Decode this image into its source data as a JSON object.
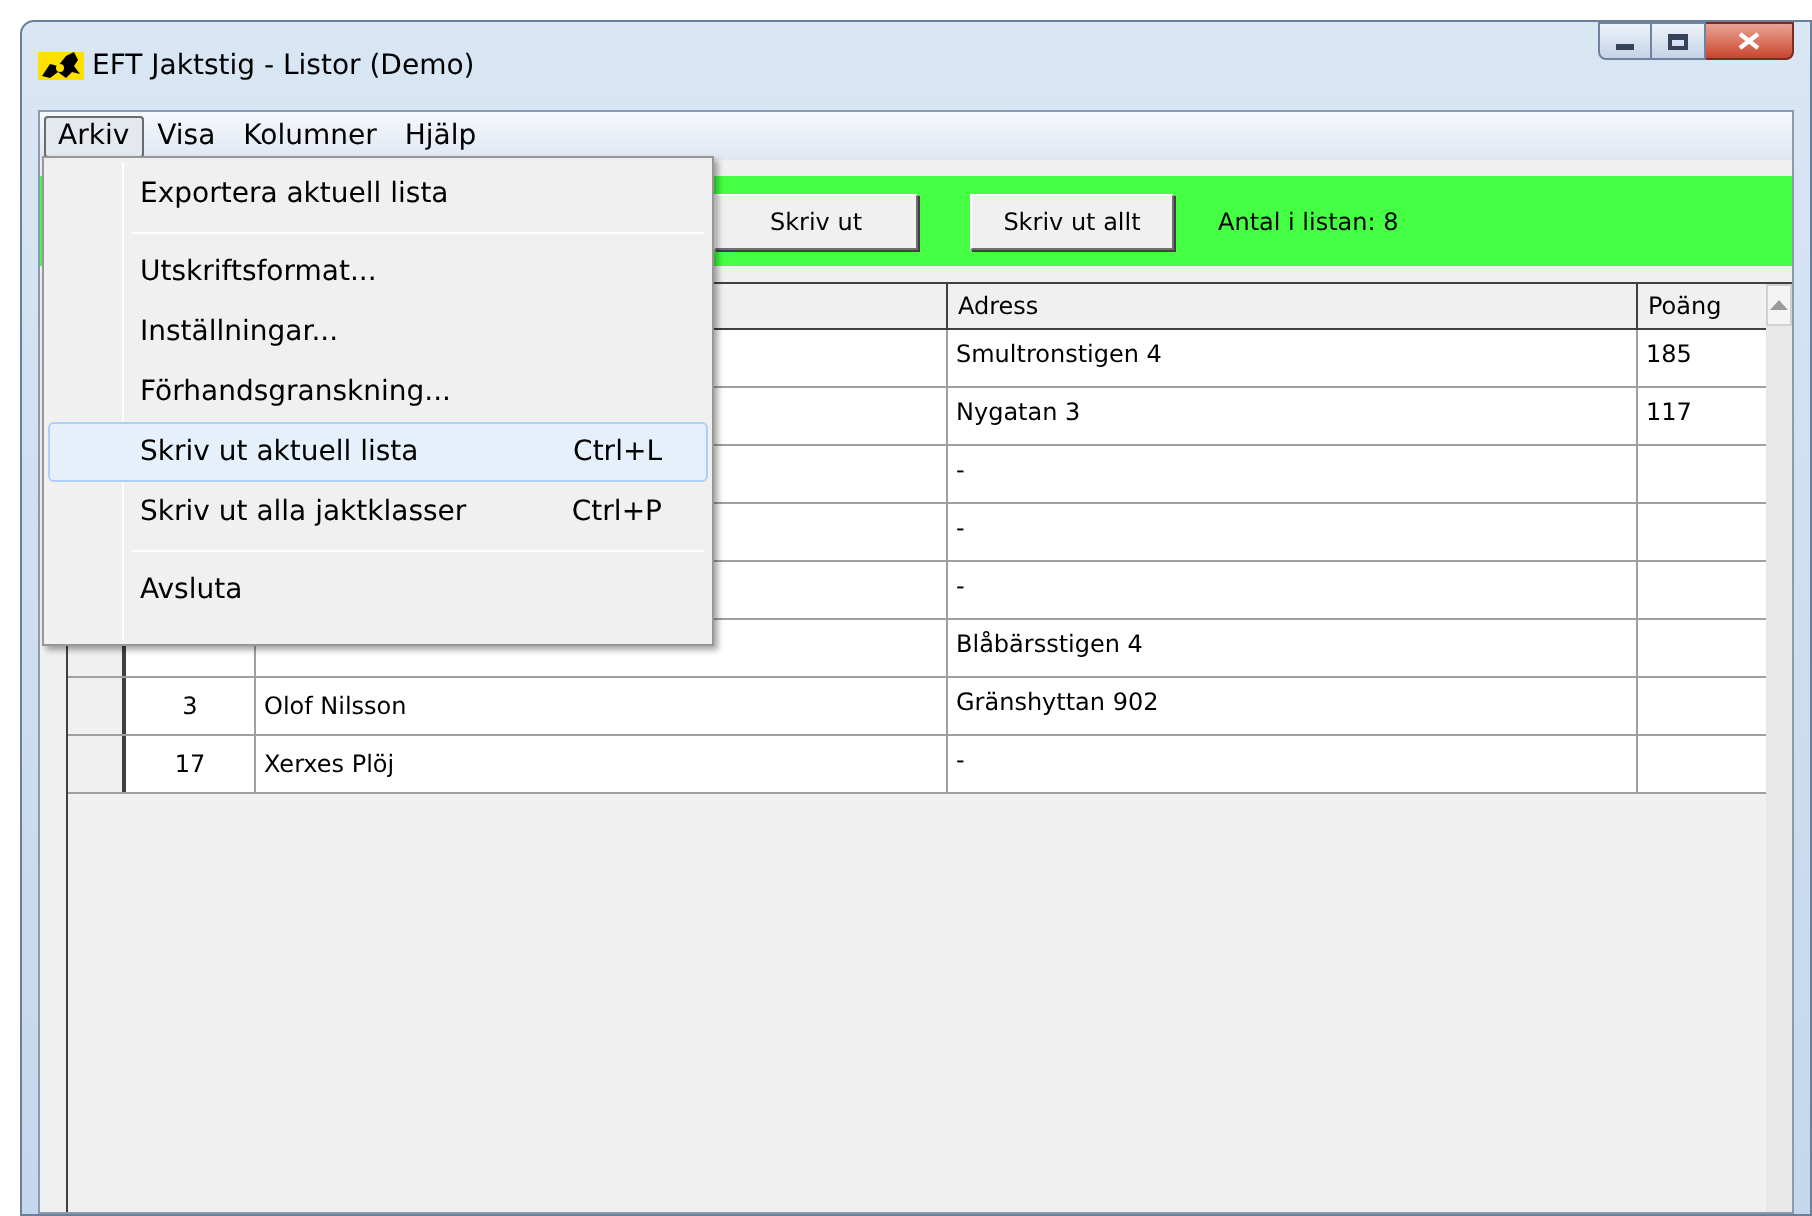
{
  "window": {
    "title": "EFT Jaktstig - Listor (Demo)"
  },
  "menu_bar": [
    {
      "label": "Arkiv",
      "selected": true
    },
    {
      "label": "Visa",
      "selected": false
    },
    {
      "label": "Kolumner",
      "selected": false
    },
    {
      "label": "Hjälp",
      "selected": false
    }
  ],
  "open_menu": [
    {
      "kind": "item",
      "label": "Exportera aktuell lista",
      "selected": false
    },
    {
      "kind": "separator"
    },
    {
      "kind": "item",
      "label": "Utskriftsformat...",
      "selected": false
    },
    {
      "kind": "item",
      "label": "Inställningar...",
      "selected": false
    },
    {
      "kind": "item",
      "label": "Förhandsgranskning...",
      "selected": false
    },
    {
      "kind": "item",
      "label": "Skriv ut aktuell lista",
      "shortcut": "Ctrl+L",
      "selected": true
    },
    {
      "kind": "item",
      "label": "Skriv ut alla jaktklasser",
      "shortcut": "Ctrl+P",
      "selected": false
    },
    {
      "kind": "separator"
    },
    {
      "kind": "item",
      "label": "Avsluta",
      "selected": false
    }
  ],
  "toolbar": {
    "buttons": [
      {
        "label": "Skriv ut"
      },
      {
        "label": "Skriv ut allt"
      }
    ],
    "count": "Antal i listan: 8"
  },
  "table": {
    "columns": [
      {
        "label": "Adress"
      },
      {
        "label": "Poäng"
      }
    ],
    "rows": [
      {
        "adress": "Smultronstigen 4",
        "poang": "185"
      },
      {
        "adress": "Nygatan 3",
        "poang": "117"
      },
      {
        "adress": "-"
      },
      {
        "adress": "-"
      },
      {
        "adress": "-"
      },
      {
        "adress": "Blåbärsstigen 4"
      },
      {
        "column_2": "3",
        "column_3": "Olof Nilsson",
        "adress": "Gränshyttan 902"
      },
      {
        "column_2": "17",
        "column_3": "Xerxes Plöj",
        "adress": "-"
      }
    ]
  }
}
